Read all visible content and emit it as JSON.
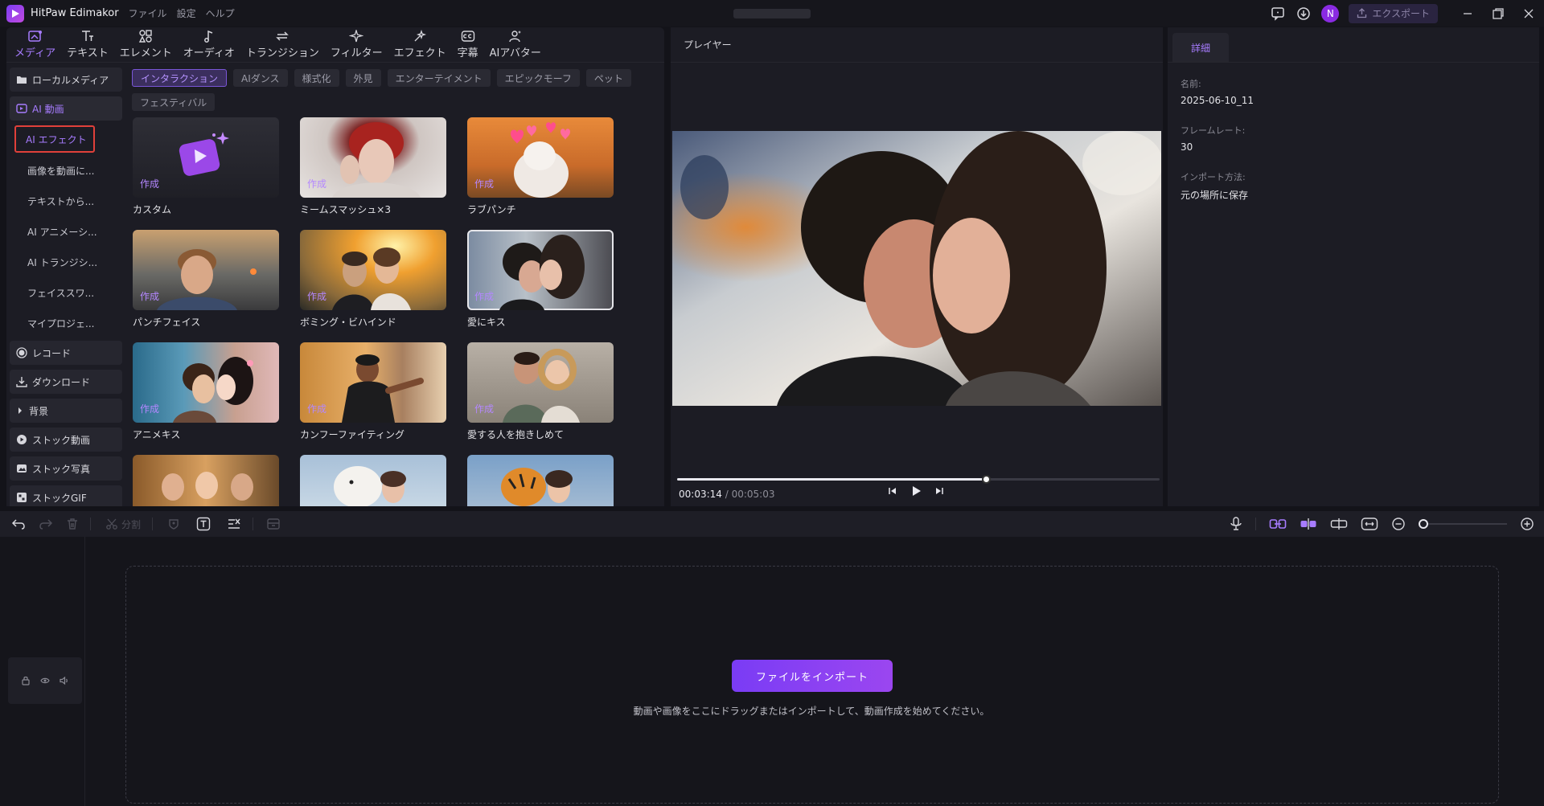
{
  "app": {
    "name": "HitPaw Edimakor",
    "menu": [
      "ファイル",
      "設定",
      "ヘルプ"
    ],
    "export_label": "エクスポート",
    "avatar_letter": "N"
  },
  "tabs": [
    {
      "label": "メディア",
      "icon": "media-icon",
      "active": true
    },
    {
      "label": "テキスト",
      "icon": "text-icon"
    },
    {
      "label": "エレメント",
      "icon": "element-icon"
    },
    {
      "label": "オーディオ",
      "icon": "audio-icon"
    },
    {
      "label": "トランジション",
      "icon": "transition-icon"
    },
    {
      "label": "フィルター",
      "icon": "filter-icon"
    },
    {
      "label": "エフェクト",
      "icon": "effect-icon"
    },
    {
      "label": "字幕",
      "icon": "subtitle-icon"
    },
    {
      "label": "AIアバター",
      "icon": "avatar-icon"
    }
  ],
  "sidebar": {
    "local_media": "ローカルメディア",
    "ai_video": "AI 動画",
    "sub_items": [
      "AI エフェクト",
      "画像を動画に...",
      "テキストから...",
      "AI アニメーシ...",
      "AI トランジシ...",
      "フェイススワ...",
      "マイプロジェ..."
    ],
    "record": "レコード",
    "download": "ダウンロード",
    "background": "背景",
    "stock_video": "ストック動画",
    "stock_photo": "ストック写真",
    "stock_gif": "ストックGIF"
  },
  "categories": [
    "インタラクション",
    "AIダンス",
    "様式化",
    "外見",
    "エンターテイメント",
    "エピックモーフ",
    "ペット",
    "フェスティバル"
  ],
  "make_label": "作成",
  "effects": [
    {
      "title": "カスタム"
    },
    {
      "title": "ミームスマッシュ×3"
    },
    {
      "title": "ラブパンチ"
    },
    {
      "title": "パンチフェイス"
    },
    {
      "title": "ボミング・ビハインド"
    },
    {
      "title": "愛にキス"
    },
    {
      "title": "アニメキス"
    },
    {
      "title": "カンフーファイティング"
    },
    {
      "title": "愛する人を抱きしめて"
    }
  ],
  "player": {
    "title": "プレイヤー",
    "current_time": "00:03:14",
    "duration": "00:05:03",
    "progress": 0.64
  },
  "details": {
    "tab": "詳細",
    "name_label": "名前:",
    "name_value": "2025-06-10_11",
    "fps_label": "フレームレート:",
    "fps_value": "30",
    "import_label": "インポート方法:",
    "import_value": "元の場所に保存"
  },
  "timeline": {
    "split_label": "分割",
    "import_button": "ファイルをインポート",
    "hint": "動画や画像をここにドラッグまたはインポートして、動画作成を始めてください。"
  },
  "colors": {
    "accent": "#a77cff",
    "import_button": "#8a40f2",
    "selection_border": "#e0403a"
  }
}
